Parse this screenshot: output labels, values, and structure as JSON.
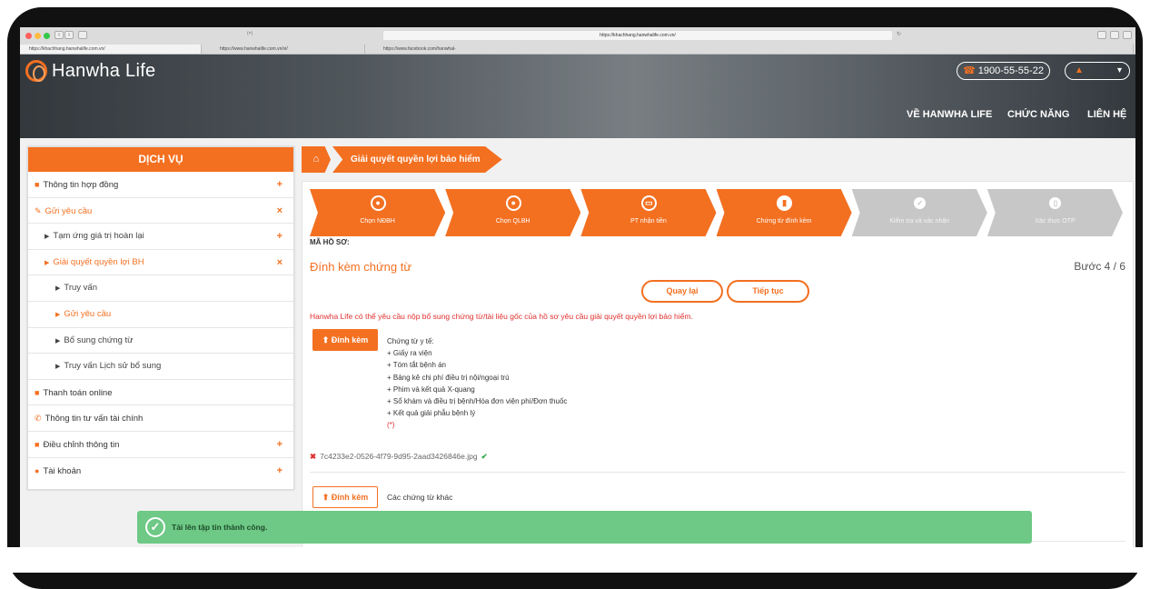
{
  "browser": {
    "url": "https://khachhang.hanwhalife.com.vn/",
    "tabs": [
      "https://khachhang.hanwhalife.com.vn/",
      "https://www.hanwhalife.com.vn/vi/",
      "https://www.facebook.com/hanwhal-"
    ],
    "extra_tab_label": "(=)"
  },
  "header": {
    "logo_text": "Hanwha Life",
    "phone": "1900-55-55-22",
    "nav": [
      "VỀ HANWHA LIFE",
      "CHỨC NĂNG",
      "LIÊN HỆ"
    ]
  },
  "sidebar": {
    "title": "DỊCH VỤ",
    "items": [
      {
        "label": "Thông tin hợp đồng",
        "toggle": "+"
      },
      {
        "label": "Gửi yêu cầu",
        "toggle": "×"
      },
      {
        "label": "Tạm ứng giá trị hoàn lại",
        "toggle": "+"
      },
      {
        "label": "Giải quyết quyền lợi BH",
        "toggle": "×"
      },
      {
        "label": "Truy vấn"
      },
      {
        "label": "Gửi yêu cầu"
      },
      {
        "label": "Bổ sung chứng từ"
      },
      {
        "label": "Truy vấn Lịch sử bổ sung"
      },
      {
        "label": "Thanh toán online"
      },
      {
        "label": "Thông tin tư vấn tài chính"
      },
      {
        "label": "Điều chỉnh thông tin",
        "toggle": "+"
      },
      {
        "label": "Tài khoản",
        "toggle": "+"
      }
    ]
  },
  "breadcrumb": {
    "current": "Giải quyết quyền lợi bảo hiểm"
  },
  "steps": [
    {
      "label": "Chọn NĐBH",
      "state": "done"
    },
    {
      "label": "Chọn QLBH",
      "state": "done"
    },
    {
      "label": "PT nhận tiền",
      "state": "done"
    },
    {
      "label": "Chứng từ đính kèm",
      "state": "current"
    },
    {
      "label": "Kiểm tra và xác nhận",
      "state": "todo"
    },
    {
      "label": "Xác thực OTP",
      "state": "todo"
    }
  ],
  "form": {
    "ho_so_label": "MÃ HỒ SƠ:",
    "title": "Đính kèm chứng từ",
    "step_count": "Bước 4 / 6",
    "back_label": "Quay lại",
    "next_label": "Tiếp tục",
    "notice": "Hanwha Life có thể yêu cầu nộp bổ sung chứng từ/tài liệu gốc của hồ sơ yêu cầu giải quyết quyền lợi bảo hiểm.",
    "attach_label": "Đính kèm",
    "medical_docs": [
      "Chứng từ y tế:",
      "+ Giấy ra viện",
      "+ Tóm tắt bệnh án",
      "+ Bảng kê chi phí điều trị nội/ngoại trú",
      "+ Phim và kết quả X-quang",
      "+ Sổ khám và điều trị bệnh/Hóa đơn viện phí/Đơn thuốc",
      "+ Kết quả giải phẫu bệnh lý"
    ],
    "required_mark": "(*)",
    "uploaded_file": "7c4233e2-0526-4f79-9d95-2aad3426846e.jpg",
    "other_docs": "Các chứng từ khác"
  },
  "toast": {
    "message": "Tải lên tập tin thành công."
  },
  "colors": {
    "accent": "#f37021",
    "success": "#6dc985",
    "inactive_step": "#c7c7c7"
  }
}
